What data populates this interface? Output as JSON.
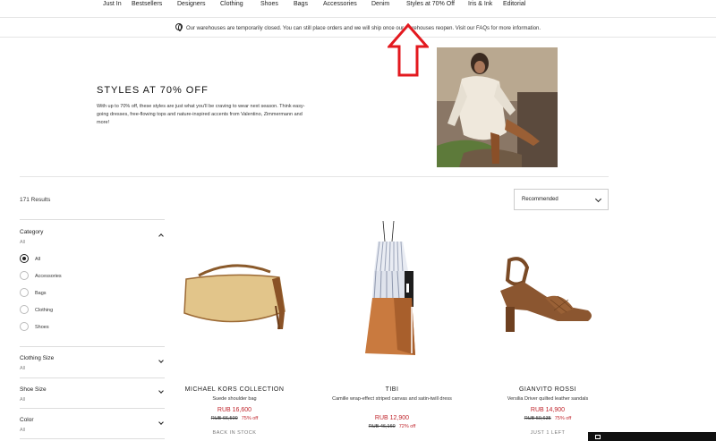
{
  "nav": {
    "items": [
      "Just In",
      "Bestsellers",
      "Designers",
      "Clothing",
      "Shoes",
      "Bags",
      "Accessories",
      "Denim",
      "Styles at 70% Off",
      "Iris & Ink",
      "Editorial"
    ]
  },
  "notice": {
    "text": "Our warehouses are temporarily closed. You can still place orders and we will ship once our warehouses reopen. Visit our FAQs for more information."
  },
  "hero": {
    "title": "STYLES AT 70% OFF",
    "description": "With up to 70% off, these styles are just what you'll be craving to wear next season. Think easy-going dresses, free-flowing tops and nature-inspired accents from Valentino, Zimmermann and more!"
  },
  "listing": {
    "results_count": "171 Results",
    "sort_value": "Recommended"
  },
  "filters": {
    "category": {
      "title": "Category",
      "selected": "All",
      "options": [
        "All",
        "Accessories",
        "Bags",
        "Clothing",
        "Shoes"
      ],
      "checked_index": 0
    },
    "clothing_size": {
      "title": "Clothing Size",
      "selected": "All"
    },
    "shoe_size": {
      "title": "Shoe Size",
      "selected": "All"
    },
    "color": {
      "title": "Color",
      "selected": "All"
    }
  },
  "products": [
    {
      "brand": "MICHAEL KORS COLLECTION",
      "name": "Suede shoulder bag",
      "price": "RUB 16,600",
      "original_price": "RUB 66,500",
      "discount": "75% off",
      "stock": "BACK IN STOCK"
    },
    {
      "brand": "TIBI",
      "name": "Camille wrap-effect striped canvas and satin-twill dress",
      "price": "RUB 12,900",
      "original_price": "RUB 46,160",
      "discount": "72% off",
      "stock": ""
    },
    {
      "brand": "GIANVITO ROSSI",
      "name": "Versilia Driver quilted leather sandals",
      "price": "RUB 14,900",
      "original_price": "RUB 59,635",
      "discount": "75% off",
      "stock": "JUST 1 LEFT"
    }
  ],
  "colors": {
    "sale_red": "#c0262d",
    "annotation_red": "#e3191f"
  }
}
